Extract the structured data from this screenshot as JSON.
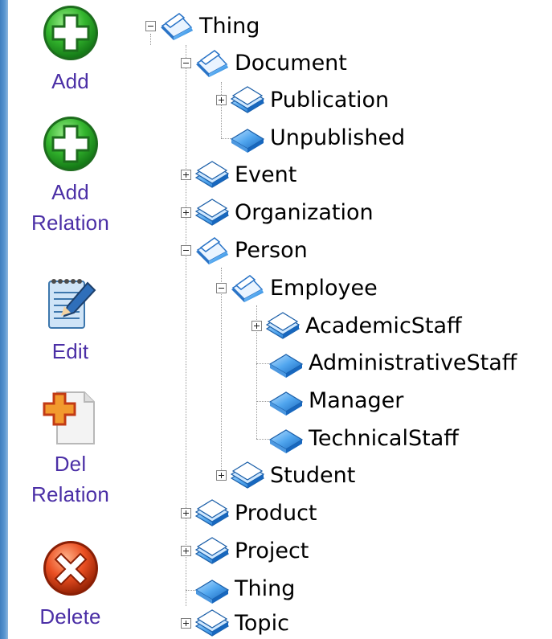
{
  "toolbar": {
    "add": "Add",
    "add_relation": [
      "Add",
      "Relation"
    ],
    "edit": "Edit",
    "del_relation": [
      "Del",
      "Relation"
    ],
    "delete": "Delete",
    "colors": {
      "label": "#4b2fa6",
      "add_green": "#27a32a",
      "delete_red": "#e24a1f"
    }
  },
  "tree": {
    "root": "Thing",
    "document": "Document",
    "publication": "Publication",
    "unpublished": "Unpublished",
    "event": "Event",
    "organization": "Organization",
    "person": "Person",
    "employee": "Employee",
    "academic_staff": "AcademicStaff",
    "administrative_staff": "AdministrativeStaff",
    "manager": "Manager",
    "technical_staff": "TechnicalStaff",
    "student": "Student",
    "product": "Product",
    "project": "Project",
    "thing_leaf": "Thing",
    "topic": "Topic"
  }
}
